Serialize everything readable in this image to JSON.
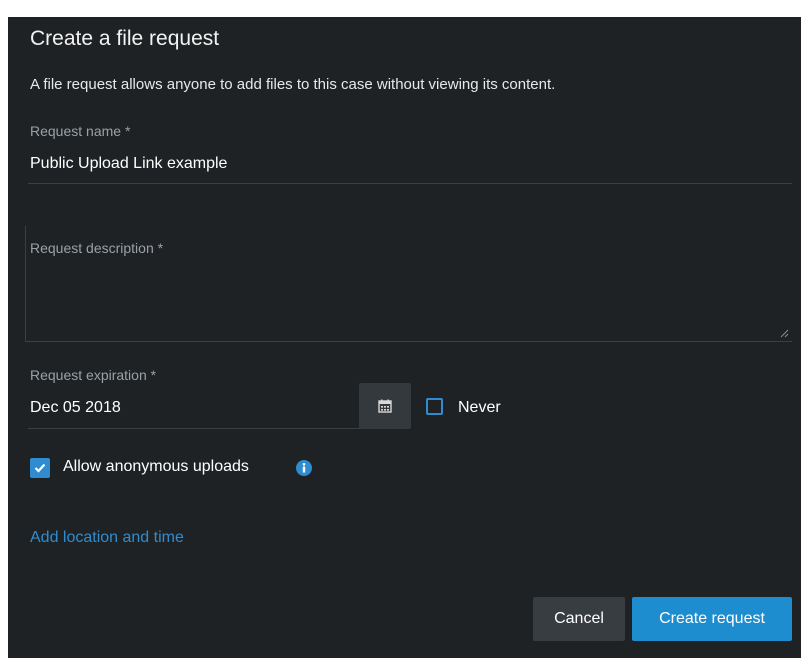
{
  "dialog": {
    "title": "Create a file request",
    "description": "A file request allows anyone to add files to this case without viewing its content."
  },
  "fields": {
    "name": {
      "label": "Request name *",
      "value": "Public Upload Link example"
    },
    "description": {
      "placeholder": "Request description *"
    },
    "expiration": {
      "label": "Request expiration *",
      "value": "Dec 05 2018",
      "calendar_icon": "calendar-icon"
    },
    "never": {
      "label": "Never",
      "checked": false
    },
    "anonymous": {
      "label": "Allow anonymous uploads",
      "checked": true,
      "info_icon": "info-icon"
    }
  },
  "links": {
    "add_location": "Add location and time"
  },
  "buttons": {
    "cancel": "Cancel",
    "create": "Create request"
  },
  "colors": {
    "background": "#1f2224",
    "accent": "#2f8cd0",
    "primary_button": "#1d8dcf",
    "secondary_button": "#383d41"
  }
}
